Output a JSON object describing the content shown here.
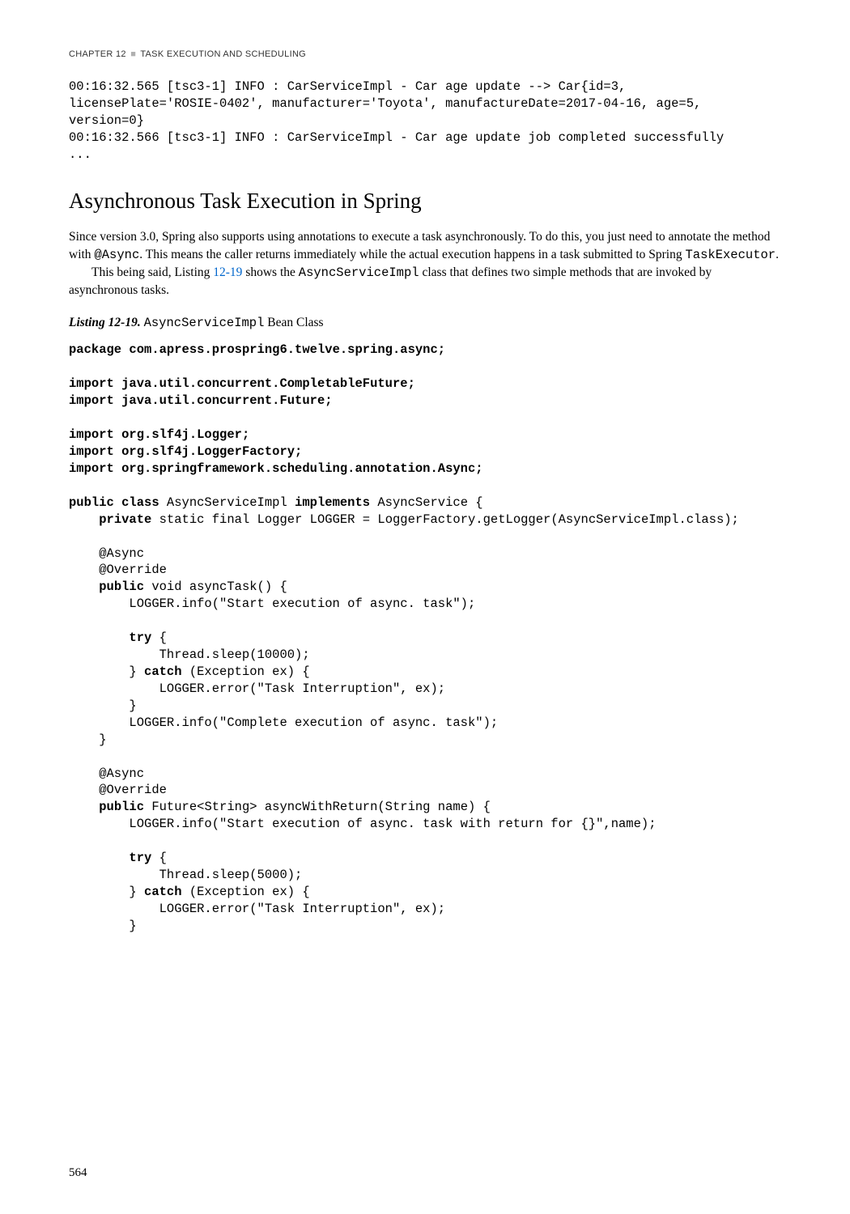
{
  "header": {
    "chapter": "CHAPTER 12",
    "separator": "■",
    "title": "TASK EXECUTION AND SCHEDULING"
  },
  "console": {
    "line1": "00:16:32.565 [tsc3-1] INFO : CarServiceImpl - Car age update --> Car{id=3, licensePlate='ROSIE-0402', manufacturer='Toyota', manufactureDate=2017-04-16, age=5, version=0}",
    "line2": "00:16:32.566 [tsc3-1] INFO : CarServiceImpl - Car age update job completed successfully",
    "line3": "..."
  },
  "section": {
    "heading": "Asynchronous Task Execution in Spring",
    "para1a": "Since version 3.0, Spring also supports using annotations to execute a task asynchronously. To do this, you just need to annotate the method with ",
    "para1b": "@Async",
    "para1c": ". This means the caller returns immediately while the actual execution happens in a task submitted to Spring ",
    "para1d": "TaskExecutor",
    "para1e": ".",
    "para2a": "This being said, Listing ",
    "para2b": "12-19",
    "para2c": " shows the ",
    "para2d": "AsyncServiceImpl",
    "para2e": " class that defines two simple methods that are invoked by asynchronous tasks."
  },
  "listing": {
    "label": "Listing 12-19.",
    "caption_code": "AsyncServiceImpl",
    "caption_suffix": " Bean Class"
  },
  "code": {
    "l01a": "package",
    "l01b": " com.apress.prospring6.twelve.spring.async;",
    "l02a": "import",
    "l02b": " java.util.concurrent.CompletableFuture;",
    "l03a": "import",
    "l03b": " java.util.concurrent.Future;",
    "l04a": "import",
    "l04b": " org.slf4j.Logger;",
    "l05a": "import",
    "l05b": " org.slf4j.LoggerFactory;",
    "l06a": "import",
    "l06b": " org.springframework.scheduling.annotation.Async;",
    "l07a": "public class",
    "l07b": " AsyncServiceImpl ",
    "l07c": "implements",
    "l07d": " AsyncService {",
    "l08a": "    ",
    "l08b": "private",
    "l08c": " static final Logger LOGGER = LoggerFactory.getLogger(AsyncServiceImpl.class);",
    "l09": "    @Async",
    "l10": "    @Override",
    "l11a": "    ",
    "l11b": "public",
    "l11c": " void asyncTask() {",
    "l12": "        LOGGER.info(\"Start execution of async. task\");",
    "l13a": "        ",
    "l13b": "try",
    "l13c": " {",
    "l14": "            Thread.sleep(10000);",
    "l15a": "        } ",
    "l15b": "catch",
    "l15c": " (Exception ex) {",
    "l16": "            LOGGER.error(\"Task Interruption\", ex);",
    "l17": "        }",
    "l18": "        LOGGER.info(\"Complete execution of async. task\");",
    "l19": "    }",
    "l20": "    @Async",
    "l21": "    @Override",
    "l22a": "    ",
    "l22b": "public",
    "l22c": " Future<String> asyncWithReturn(String name) {",
    "l23": "        LOGGER.info(\"Start execution of async. task with return for {}\",name);",
    "l24a": "        ",
    "l24b": "try",
    "l24c": " {",
    "l25": "            Thread.sleep(5000);",
    "l26a": "        } ",
    "l26b": "catch",
    "l26c": " (Exception ex) {",
    "l27": "            LOGGER.error(\"Task Interruption\", ex);",
    "l28": "        }"
  },
  "page_number": "564"
}
